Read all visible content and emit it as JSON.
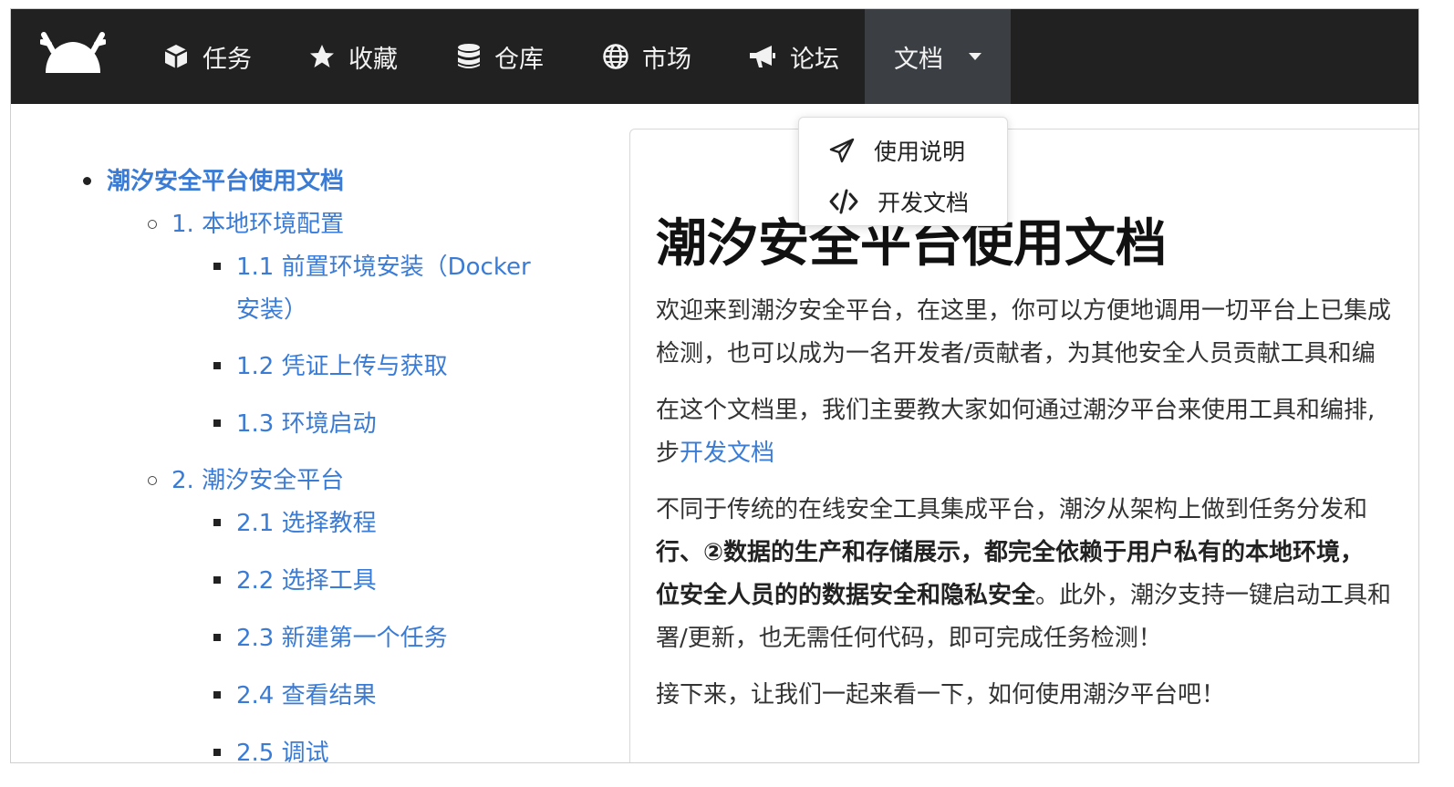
{
  "nav": {
    "items": [
      {
        "label": "任务",
        "icon": "cube-icon"
      },
      {
        "label": "收藏",
        "icon": "star-icon"
      },
      {
        "label": "仓库",
        "icon": "database-icon"
      },
      {
        "label": "市场",
        "icon": "globe-icon"
      },
      {
        "label": "论坛",
        "icon": "megaphone-icon"
      }
    ],
    "docs_label": "文档"
  },
  "dropdown": {
    "items": [
      {
        "label": "使用说明",
        "icon": "paper-plane-icon"
      },
      {
        "label": "开发文档",
        "icon": "code-icon"
      }
    ]
  },
  "toc": {
    "title": "潮汐安全平台使用文档",
    "s1": "1. 本地环境配置",
    "s1_1a": "1.1 前置环境安装（Docker",
    "s1_1b": "安装）",
    "s1_2": "1.2 凭证上传与获取",
    "s1_3": "1.3 环境启动",
    "s2": "2. 潮汐安全平台",
    "s2_1": "2.1 选择教程",
    "s2_2": "2.2 选择工具",
    "s2_3": "2.3 新建第一个任务",
    "s2_4": "2.4 查看结果",
    "s2_5": "2.5 调试"
  },
  "doc": {
    "title": "潮汐安全平台使用文档",
    "p1_l1": "欢迎来到潮汐安全平台，在这里，你可以方便地调用一切平台上已集成",
    "p1_l2": "检测，也可以成为一名开发者/贡献者，为其他安全人员贡献工具和编",
    "p2_l1": "在这个文档里，我们主要教大家如何通过潮汐平台来使用工具和编排,",
    "p2_l2_pre": "步",
    "p2_link": "开发文档",
    "p3_l1": "不同于传统的在线安全工具集成平台，潮汐从架构上做到任务分发和",
    "p3_l2": "行、②数据的生产和存储展示，都完全依赖于用户私有的本地环境，",
    "p3_l3_bold": "位安全人员的的数据安全和隐私安全",
    "p3_l3_rest": "。此外，潮汐支持一键启动工具和",
    "p3_l4": "署/更新，也无需任何代码，即可完成任务检测！",
    "p4": "接下来，让我们一起来看一下，如何使用潮汐平台吧！"
  }
}
